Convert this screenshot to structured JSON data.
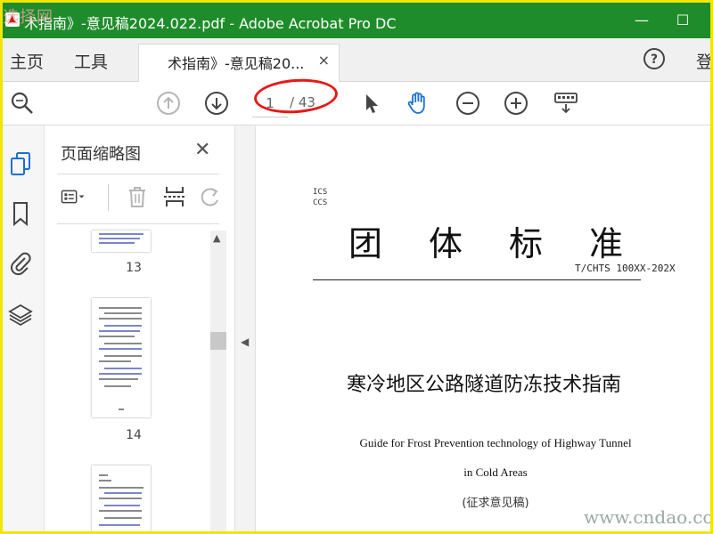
{
  "window": {
    "title": "术指南》-意见稿2024.022.pdf - Adobe Acrobat Pro DC",
    "minimize_glyph": "—",
    "maximize_glyph": "☐",
    "watermark_top_left": "选择网"
  },
  "menu": {
    "home": "主页",
    "tools": "工具",
    "login": "登"
  },
  "tab": {
    "label": "术指南》-意见稿20...",
    "close_glyph": "×"
  },
  "toolbar": {
    "current_page": "1",
    "page_total": "/ 43",
    "icons": [
      "zoom-search-icon",
      "page-up-icon",
      "page-down-icon",
      "select-pointer-icon",
      "hand-tool-icon",
      "zoom-out-icon",
      "zoom-in-icon",
      "keyboard-icon"
    ],
    "highlight_color": "#e81818"
  },
  "sidebar": {
    "icons": [
      "page-thumbnails-icon",
      "bookmark-icon",
      "attachment-icon",
      "layers-icon"
    ]
  },
  "thumbnails_panel": {
    "title": "页面缩略图",
    "close_glyph": "✕",
    "pages": [
      {
        "number": "13"
      },
      {
        "number": "14"
      }
    ]
  },
  "document": {
    "ics": "ICS",
    "ccs": "CCS",
    "standard_title": "团体标准",
    "standard_code": "T/CHTS 100XX-202X",
    "title_cn": "寒冷地区公路隧道防冻技术指南",
    "title_en_line1": "Guide for Frost Prevention technology of Highway Tunnel",
    "title_en_line2": "in Cold Areas",
    "status": "(征求意见稿)",
    "watermark": "www.cndao.com"
  },
  "colors": {
    "titlebar": "#1e8c2a",
    "frame": "#f2e600"
  }
}
